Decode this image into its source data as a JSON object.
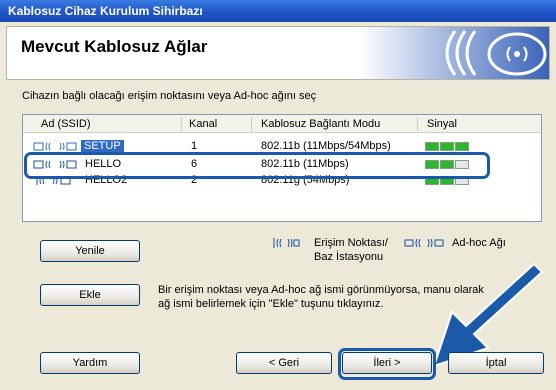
{
  "window": {
    "title": "Kablosuz Cihaz Kurulum Sihirbazı"
  },
  "banner": {
    "title": "Mevcut Kablosuz Ağlar"
  },
  "instruction": "Cihazın bağlı olacağı erişim noktasını veya Ad-hoc ağını seç",
  "table": {
    "headers": [
      "Ad (SSID)",
      "Kanal",
      "Kablosuz Bağlantı Modu",
      "Sinyal"
    ],
    "rows": [
      {
        "ssid": "SETUP",
        "channel": "1",
        "mode": "802.11b (11Mbps/54Mbps)",
        "signal_bars": 3,
        "selected": true
      },
      {
        "ssid": "HELLO",
        "channel": "6",
        "mode": "802.11b (11Mbps)",
        "signal_bars": 2,
        "selected": false
      },
      {
        "ssid": "HELLO2",
        "channel": "2",
        "mode": "802.11g (54Mbps)",
        "signal_bars": 2,
        "selected": false
      }
    ]
  },
  "legend": {
    "access_point": "Erişim Noktası/",
    "base_station": "Baz İstasyonu",
    "adhoc": "Ad-hoc Ağı"
  },
  "buttons": {
    "refresh": "Yenile",
    "add": "Ekle",
    "help": "Yardım",
    "back": "< Geri",
    "next": "İleri >",
    "cancel": "İptal"
  },
  "add_note": "Bir erişim noktası veya Ad-hoc ağ ismi görünmüyorsa, manu olarak ağ ismi belirlemek için \"Ekle\" tuşunu tıklayınız.",
  "colors": {
    "accent": "#1a5aa8",
    "selection": "#316ac5",
    "signal_on": "#2db52d",
    "signal_off": "#e6e6e6"
  }
}
